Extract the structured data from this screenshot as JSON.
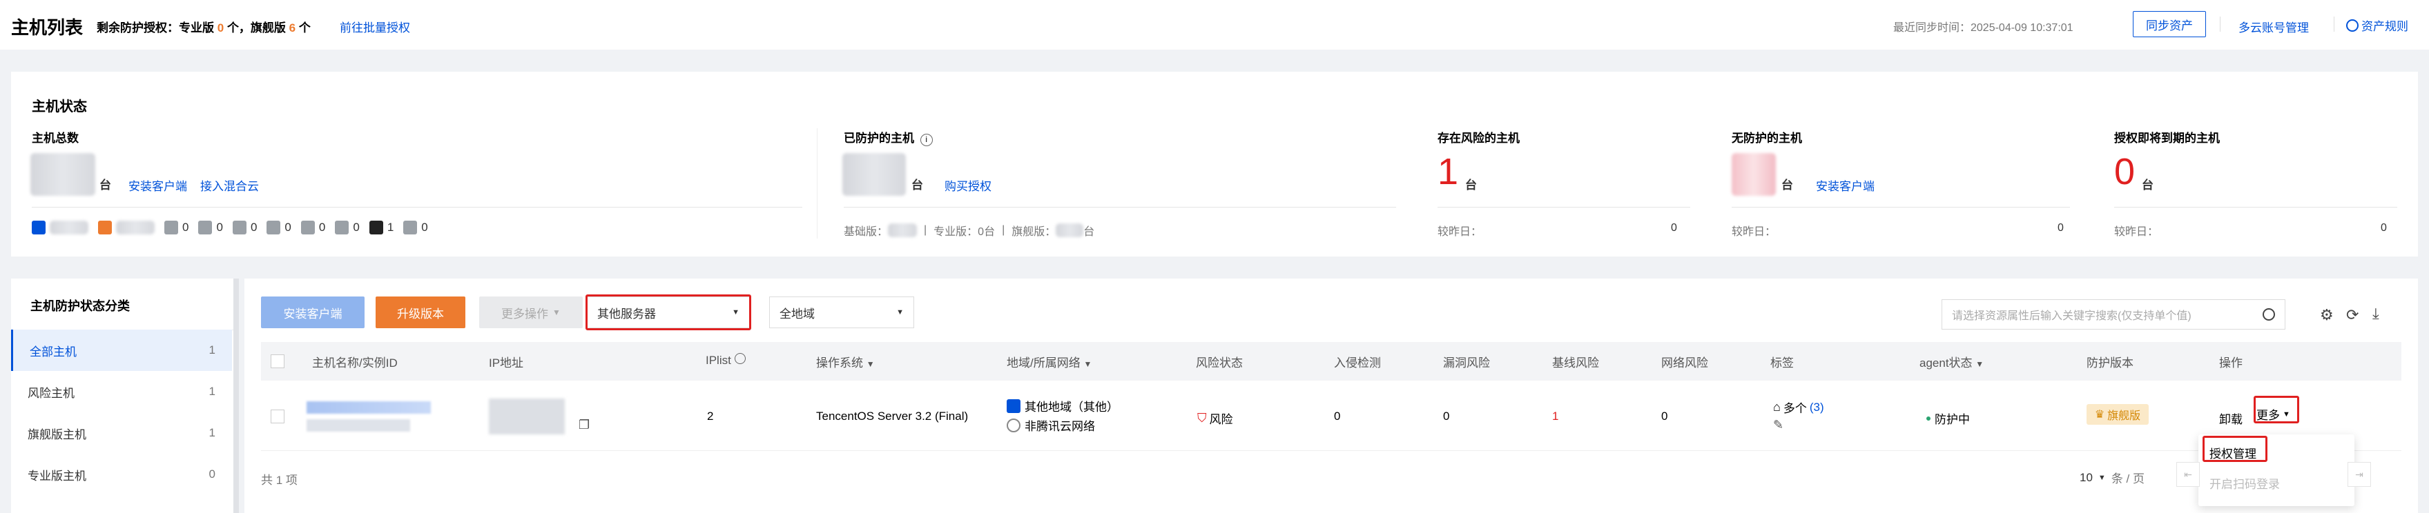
{
  "header": {
    "title": "主机列表",
    "license_prefix": "剩余防护授权：专业版",
    "pro_count": "0",
    "unit1": "个，旗舰版",
    "flagship_count": "6",
    "unit2": "个",
    "bulk_link": "前往批量授权",
    "sync_time": "最近同步时间：2025-04-09 10:37:01",
    "sync_button": "同步资产",
    "multicloud": "多云账号管理",
    "asset_rules": "资产规则"
  },
  "status": {
    "section_title": "主机状态",
    "total": {
      "label": "主机总数",
      "unit": "台",
      "install_link": "安装客户端",
      "hybrid_link": "接入混合云"
    },
    "chips": [
      "0",
      "0",
      "0",
      "0",
      "0",
      "0",
      "0",
      "1",
      "0"
    ],
    "protected": {
      "label": "已防护的主机",
      "unit": "台",
      "buy_link": "购买授权",
      "basic": "基础版：",
      "pro": "专业版：0台",
      "flagship": "旗舰版：",
      "flagship_unit": "台"
    },
    "risk": {
      "label": "存在风险的主机",
      "value": "1",
      "unit": "台",
      "compare": "较昨日：",
      "compare_value": "0"
    },
    "unprotected": {
      "label": "无防护的主机",
      "unit": "台",
      "install_link": "安装客户端",
      "compare": "较昨日：",
      "compare_value": "0"
    },
    "expiring": {
      "label": "授权即将到期的主机",
      "value": "0",
      "unit": "台",
      "compare": "较昨日：",
      "compare_value": "0"
    }
  },
  "sidebar": {
    "title": "主机防护状态分类",
    "items": [
      {
        "label": "全部主机",
        "count": "1"
      },
      {
        "label": "风险主机",
        "count": "1"
      },
      {
        "label": "旗舰版主机",
        "count": "1"
      },
      {
        "label": "专业版主机",
        "count": "0"
      }
    ]
  },
  "toolbar": {
    "install": "安装客户端",
    "upgrade": "升级版本",
    "more": "更多操作",
    "server_type": "其他服务器",
    "region": "全地域",
    "search_placeholder": "请选择资源属性后输入关键字搜索(仅支持单个值)"
  },
  "table": {
    "headers": [
      "主机名称/实例ID",
      "IP地址",
      "IPlist",
      "操作系统",
      "地域/所属网络",
      "风险状态",
      "入侵检测",
      "漏洞风险",
      "基线风险",
      "网络风险",
      "标签",
      "agent状态",
      "防护版本",
      "操作"
    ],
    "row": {
      "iplist": "2",
      "os": "TencentOS Server 3.2 (Final)",
      "region": "其他地域（其他）",
      "network": "非腾讯云网络",
      "risk": "风险",
      "intrusion": "0",
      "vuln": "0",
      "baseline": "1",
      "network_risk": "0",
      "tags": "多个",
      "tags_count": "(3)",
      "agent": "防护中",
      "version": "旗舰版",
      "uninstall": "卸载",
      "more": "更多"
    },
    "total": "共 1 项",
    "page_size": "10",
    "page_unit": "条 / 页"
  },
  "dropdown": {
    "items": [
      "授权管理",
      "开启扫码登录"
    ]
  },
  "colors": {
    "accent": "#0052d9",
    "danger": "#e02020",
    "orange": "#ed7b2f"
  }
}
